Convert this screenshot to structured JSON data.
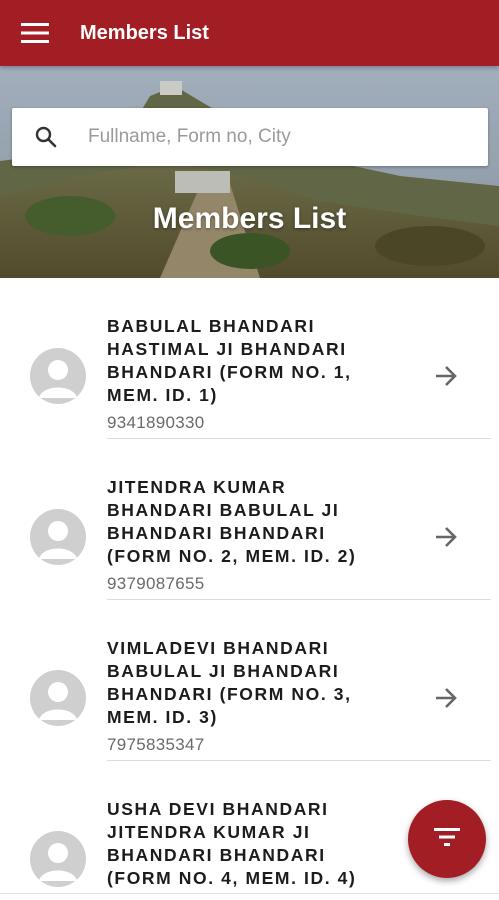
{
  "app_bar": {
    "title": "Members List",
    "menu_icon": "hamburger-menu-icon",
    "color": "#a31d24"
  },
  "hero": {
    "title": "Members List",
    "search": {
      "placeholder": "Fullname, Form no, City",
      "value": "",
      "icon": "search-icon"
    }
  },
  "members": [
    {
      "name": "BABULAL BHANDARI HASTIMAL JI BHANDARI BHANDARI (FORM NO. 1, MEM. ID. 1)",
      "phone": "9341890330"
    },
    {
      "name": "JITENDRA KUMAR BHANDARI BABULAL JI BHANDARI BHANDARI (FORM NO. 2, MEM. ID. 2)",
      "phone": "9379087655"
    },
    {
      "name": "VIMLADEVI BHANDARI BABULAL JI BHANDARI BHANDARI (FORM NO. 3, MEM. ID. 3)",
      "phone": "7975835347"
    },
    {
      "name": "USHA DEVI BHANDARI JITENDRA KUMAR JI BHANDARI BHANDARI (FORM NO. 4, MEM. ID. 4)",
      "phone": ""
    }
  ],
  "fab": {
    "icon": "filter-icon"
  }
}
